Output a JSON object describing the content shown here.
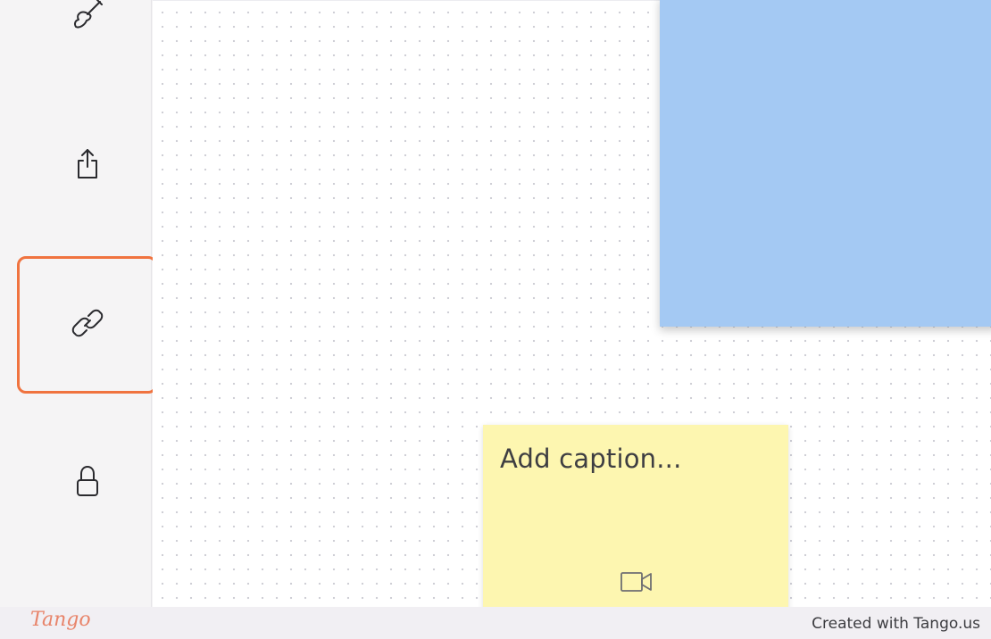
{
  "toolbar": {
    "items": [
      {
        "name": "brush",
        "icon": "brush-icon"
      },
      {
        "name": "share",
        "icon": "share-icon"
      },
      {
        "name": "link",
        "icon": "link-icon",
        "highlighted": true
      },
      {
        "name": "lock",
        "icon": "lock-icon"
      }
    ],
    "highlight_color": "#f0733f"
  },
  "canvas": {
    "blue_note_color": "#a4c9f3",
    "yellow_note": {
      "caption_placeholder": "Add caption...",
      "color": "#fdf6b0",
      "icon": "video-camera-icon"
    }
  },
  "footer": {
    "logo": "Tango",
    "credit": "Created with Tango.us"
  }
}
